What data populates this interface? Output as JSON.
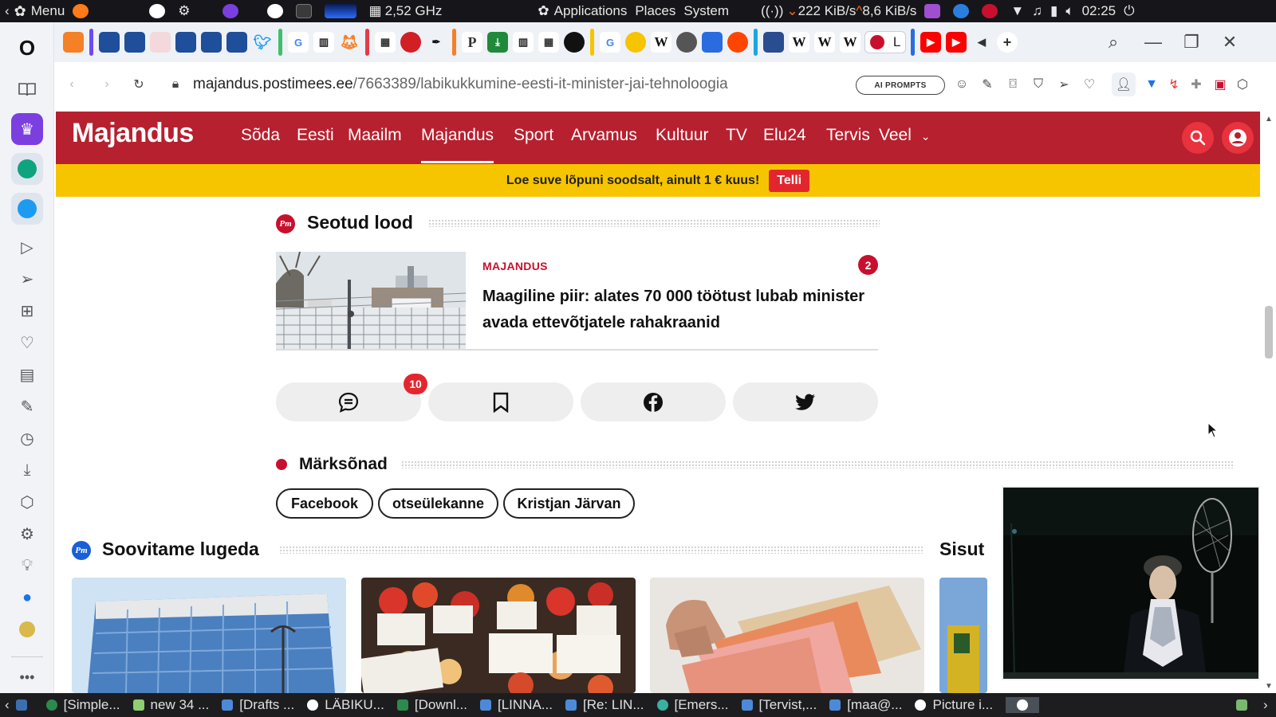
{
  "system_bar": {
    "menu_label": "Menu",
    "cpu_freq": "2,52 GHz",
    "menus": [
      "Applications",
      "Places",
      "System"
    ],
    "net_down": "222 KiB/s",
    "net_up": "8,6 KiB/s",
    "clock": "02:25"
  },
  "browser": {
    "url_host": "majandus.postimees.ee",
    "url_path": "/7663389/labikukkumine-eesti-it-minister-jai-tehnoloogia",
    "ai_prompts_label": "AI PROMPTS",
    "active_tab_label": "L",
    "tab_letters": {
      "w1": "W",
      "w2": "W",
      "w3": "W",
      "w4": "W",
      "p": "P",
      "g1": "G",
      "g2": "G"
    }
  },
  "site": {
    "logo": "Majandus",
    "nav": [
      "Sõda",
      "Eesti",
      "Maailm",
      "Majandus",
      "Sport",
      "Arvamus",
      "Kultuur",
      "TV",
      "Elu24",
      "Tervis",
      "Veel"
    ],
    "active_nav": "Majandus",
    "promo_text": "Loe suve lõpuni soodsalt, ainult 1 € kuus!",
    "promo_button": "Telli"
  },
  "related": {
    "title": "Seotud lood",
    "badge": "Pm",
    "article": {
      "category": "MAJANDUS",
      "comment_count": "2",
      "headline_line1": "Maagiline piir: alates 70 000 töötust lubab minister",
      "headline_line2": "avada ettevõtjatele rahakraanid"
    }
  },
  "actions": {
    "comments_count": "10"
  },
  "keywords": {
    "title": "Märksõnad",
    "tags": [
      "Facebook",
      "otseülekanne",
      "Kristjan Järvan"
    ]
  },
  "recommended": {
    "title": "Soovitame lugeda",
    "badge": "Pm",
    "side_title": "Sisut"
  },
  "taskbar": {
    "items": [
      "[Simple...",
      "new 34 ...",
      "[Drafts ...",
      "LÄBIKU...",
      "[Downl...",
      "[LINNA...",
      "[Re: LIN...",
      "[Emers...",
      "[Tervist,...",
      "[maa@...",
      "Picture i..."
    ]
  },
  "colors": {
    "brand_red": "#b7202e",
    "promo_yellow": "#f7c400",
    "promo_button": "#e3262e",
    "category_red": "#c8102e",
    "pm_blue": "#1b5fd6"
  }
}
